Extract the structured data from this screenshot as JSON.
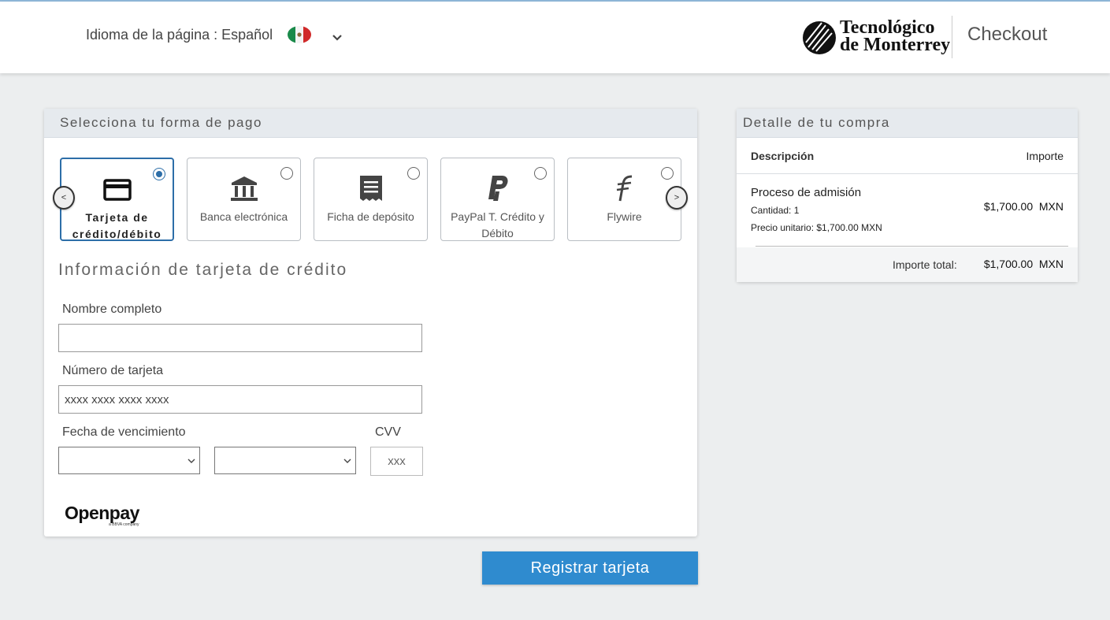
{
  "header": {
    "language_label": "Idioma de la página : Español",
    "logo_line1": "Tecnológico",
    "logo_line2": "de Monterrey",
    "checkout": "Checkout"
  },
  "payment": {
    "title": "Selecciona tu forma de pago",
    "prev_label": "<",
    "next_label": ">",
    "methods": [
      {
        "label": "Tarjeta de crédito/débito",
        "icon": "credit-card-icon",
        "selected": true
      },
      {
        "label": "Banca electrónica",
        "icon": "bank-icon",
        "selected": false
      },
      {
        "label": "Ficha de depósito",
        "icon": "receipt-icon",
        "selected": false
      },
      {
        "label": "PayPal T. Crédito y Débito",
        "icon": "paypal-icon",
        "selected": false
      },
      {
        "label": "Flywire",
        "icon": "flywire-icon",
        "selected": false
      }
    ]
  },
  "card_form": {
    "title": "Información de tarjeta de crédito",
    "name_label": "Nombre completo",
    "name_value": "",
    "number_label": "Número de tarjeta",
    "number_placeholder": "xxxx xxxx xxxx xxxx",
    "expiry_label": "Fecha de vencimiento",
    "month_value": "",
    "year_value": "",
    "cvv_label": "CVV",
    "cvv_placeholder": "xxx",
    "provider": "Openpay",
    "provider_sub": "a BBVA company"
  },
  "register_button": "Registrar tarjeta",
  "summary": {
    "title": "Detalle de tu compra",
    "col_description": "Descripción",
    "col_amount": "Importe",
    "item_name": "Proceso de admisión",
    "item_quantity": "Cantidad: 1",
    "item_unit_price": "Precio unitario: $1,700.00 MXN",
    "item_amount": "$1,700.00  MXN",
    "total_label": "Importe total:",
    "total_amount": "$1,700.00  MXN"
  },
  "colors": {
    "accent": "#2f8bcf",
    "selected_border": "#2d6ea8",
    "panel_header": "#e6eaee"
  }
}
